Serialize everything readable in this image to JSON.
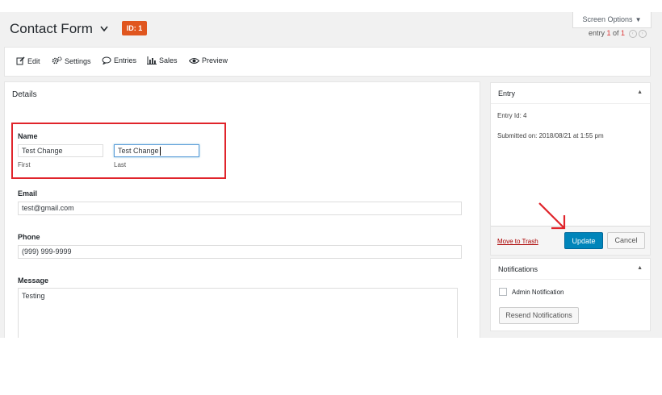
{
  "header": {
    "title": "Contact Form",
    "id_badge": "ID: 1",
    "screen_options": "Screen Options",
    "entry_prefix": "entry ",
    "entry_current": "1",
    "entry_of": " of ",
    "entry_total": "1"
  },
  "toolbar": {
    "edit": "Edit",
    "settings": "Settings",
    "entries": "Entries",
    "sales": "Sales",
    "preview": "Preview"
  },
  "details": {
    "title": "Details",
    "name": {
      "label": "Name",
      "first_value": "Test Change",
      "first_sub": "First",
      "last_value": "Test Change",
      "last_sub": "Last"
    },
    "email": {
      "label": "Email",
      "value": "test@gmail.com"
    },
    "phone": {
      "label": "Phone",
      "value": "(999) 999-9999"
    },
    "message": {
      "label": "Message",
      "value": "Testing"
    }
  },
  "entry_box": {
    "title": "Entry",
    "entry_id": "Entry Id: 4",
    "submitted": "Submitted on: 2018/08/21 at 1:55 pm",
    "trash": "Move to Trash",
    "update": "Update",
    "cancel": "Cancel"
  },
  "notifications": {
    "title": "Notifications",
    "admin": "Admin Notification",
    "resend": "Resend Notifications"
  },
  "colors": {
    "highlight": "#e0242b",
    "badge": "#e0561f",
    "primary": "#0085ba"
  }
}
